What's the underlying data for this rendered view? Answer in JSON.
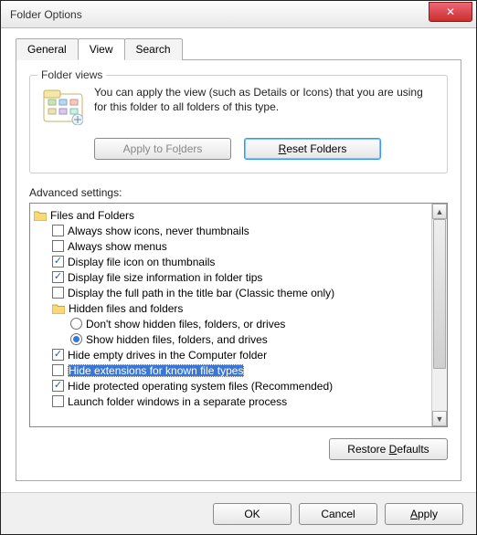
{
  "window": {
    "title": "Folder Options"
  },
  "tabs": {
    "general": "General",
    "view": "View",
    "search": "Search",
    "active": "view"
  },
  "group": {
    "legend": "Folder views",
    "desc": "You can apply the view (such as Details or Icons) that you are using for this folder to all folders of this type.",
    "apply_btn": "Apply to Folders",
    "apply_ul": "l",
    "reset_btn": "Reset Folders",
    "reset_ul": "R"
  },
  "adv_label": "Advanced settings:",
  "tree": {
    "root": "Files and Folders",
    "items": [
      {
        "type": "check",
        "checked": false,
        "label": "Always show icons, never thumbnails"
      },
      {
        "type": "check",
        "checked": false,
        "label": "Always show menus"
      },
      {
        "type": "check",
        "checked": true,
        "label": "Display file icon on thumbnails"
      },
      {
        "type": "check",
        "checked": true,
        "label": "Display file size information in folder tips"
      },
      {
        "type": "check",
        "checked": false,
        "label": "Display the full path in the title bar (Classic theme only)"
      },
      {
        "type": "folder",
        "label": "Hidden files and folders"
      },
      {
        "type": "radio",
        "checked": false,
        "label": "Don't show hidden files, folders, or drives",
        "lvl": 2
      },
      {
        "type": "radio",
        "checked": true,
        "label": "Show hidden files, folders, and drives",
        "lvl": 2
      },
      {
        "type": "check",
        "checked": true,
        "label": "Hide empty drives in the Computer folder"
      },
      {
        "type": "check",
        "checked": false,
        "label": "Hide extensions for known file types",
        "selected": true
      },
      {
        "type": "check",
        "checked": true,
        "label": "Hide protected operating system files (Recommended)"
      },
      {
        "type": "check",
        "checked": false,
        "label": "Launch folder windows in a separate process"
      }
    ]
  },
  "restore_btn": "Restore Defaults",
  "restore_ul": "D",
  "footer": {
    "ok": "OK",
    "cancel": "Cancel",
    "apply": "Apply",
    "apply_ul": "A"
  }
}
